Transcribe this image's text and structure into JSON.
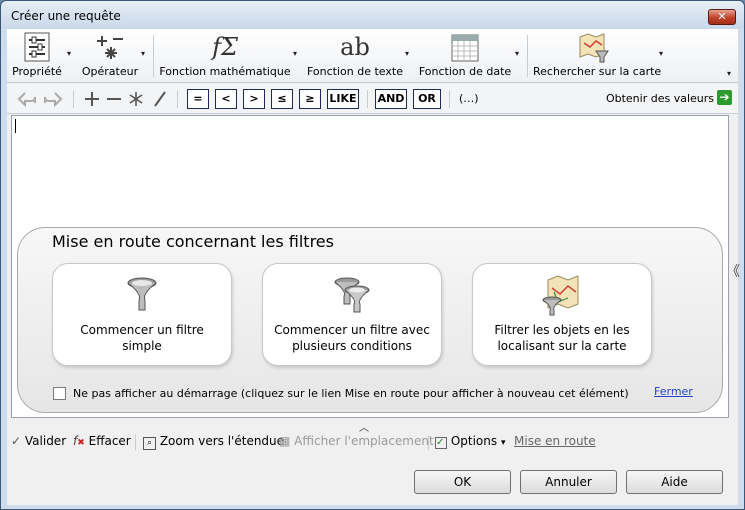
{
  "window": {
    "title": "Créer une requête",
    "close_glyph": "✕"
  },
  "toolbar1": {
    "items": [
      {
        "label": "Propriété",
        "icon": "property-icon"
      },
      {
        "label": "Opérateur",
        "icon": "operator-icon"
      },
      {
        "label": "Fonction mathématique",
        "icon": "math-function-icon"
      },
      {
        "label": "Fonction de texte",
        "icon": "text-function-icon"
      },
      {
        "label": "Fonction de date",
        "icon": "date-function-icon"
      },
      {
        "label": "Rechercher sur la carte",
        "icon": "map-search-icon"
      }
    ],
    "math_glyph": "fΣ",
    "text_glyph": "ab",
    "dropdown_glyph": "▾",
    "overflow_glyph": "▾"
  },
  "toolbar2": {
    "operators": [
      "=",
      "<",
      ">",
      "≤",
      "≥",
      "LIKE",
      "AND",
      "OR"
    ],
    "ellipsis": "(…)",
    "obtain_values": "Obtenir des valeurs",
    "obtain_arrow": "➔"
  },
  "getting_started": {
    "title": "Mise en route concernant les filtres",
    "cards": [
      {
        "label": "Commencer un filtre simple"
      },
      {
        "label": "Commencer un filtre avec plusieurs conditions"
      },
      {
        "label": "Filtrer les objets en les localisant sur la carte"
      }
    ],
    "dont_show": "Ne pas afficher au démarrage (cliquez sur le lien Mise en route pour afficher à nouveau cet élément)",
    "close": "Fermer"
  },
  "actions": {
    "validate": "Valider",
    "clear": "Effacer",
    "zoom": "Zoom vers l'étendue",
    "show_location": "Afficher l'emplacement",
    "options": "Options",
    "getting_started": "Mise en route"
  },
  "buttons": {
    "ok": "OK",
    "cancel": "Annuler",
    "help": "Aide"
  },
  "glyphs": {
    "collapse_left": "《",
    "collapse_up": "︿"
  }
}
